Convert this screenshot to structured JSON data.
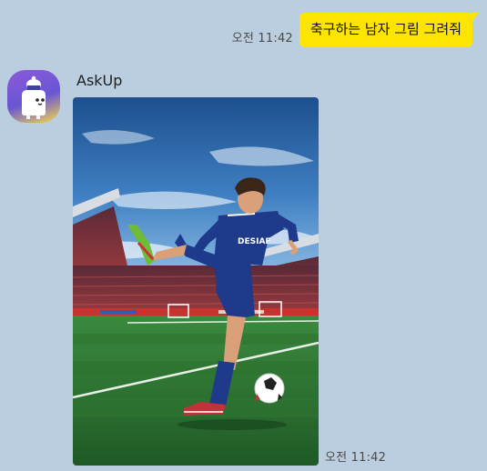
{
  "outgoing": {
    "text": "축구하는 남자 그림 그려줘",
    "time": "오전 11:42"
  },
  "incoming": {
    "sender": "AskUp",
    "time": "오전 11:42",
    "image_jersey_text": "DESIAF"
  },
  "colors": {
    "background": "#bacee0",
    "my_bubble": "#fee500",
    "grass": "#2e7a36",
    "jersey": "#1f3a8a"
  }
}
